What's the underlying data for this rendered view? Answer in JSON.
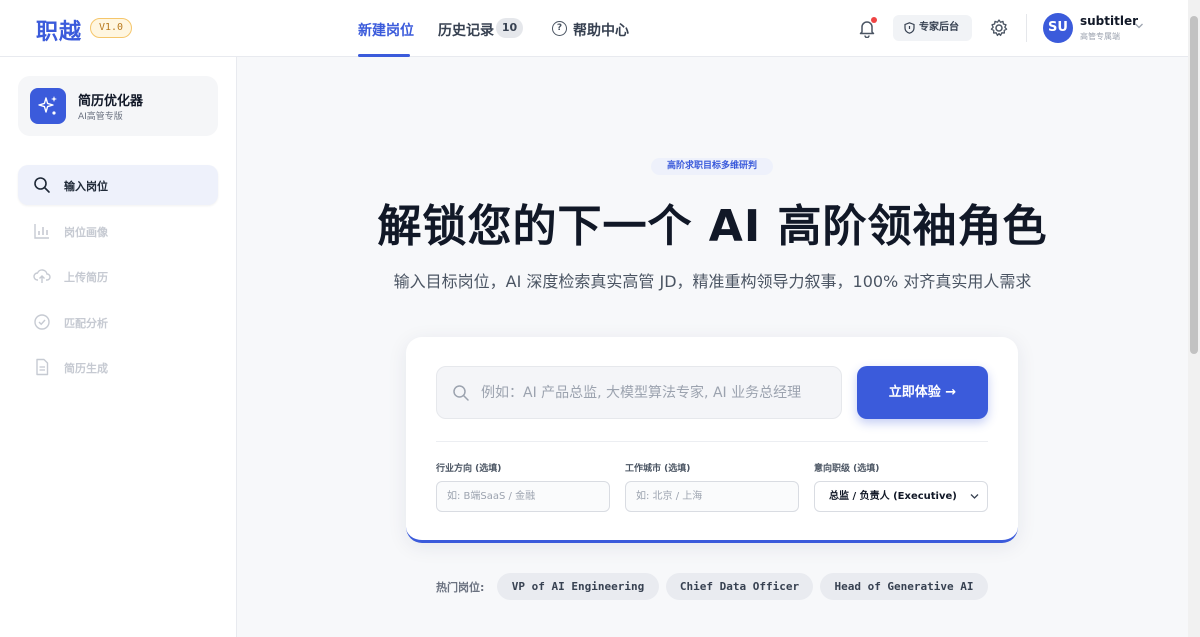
{
  "header": {
    "logo": "职越",
    "version": "V1.0",
    "tabs": [
      {
        "label": "新建岗位",
        "active": true
      },
      {
        "label": "历史记录",
        "badge": "10"
      },
      {
        "label": "帮助中心",
        "icon": "question-circle-icon"
      }
    ],
    "notification_icon": "bell-icon",
    "expert_label": "专家后台",
    "settings_icon": "gear-icon",
    "user": {
      "initials": "SU",
      "name": "subtitler",
      "role": "高管专属端"
    }
  },
  "sidebar": {
    "brand": {
      "title": "简历优化器",
      "subtitle": "AI高管专版"
    },
    "items": [
      {
        "label": "输入岗位",
        "icon": "search-icon",
        "active": true
      },
      {
        "label": "岗位画像",
        "icon": "bar-chart-icon"
      },
      {
        "label": "上传简历",
        "icon": "cloud-upload-icon"
      },
      {
        "label": "匹配分析",
        "icon": "check-circle-icon"
      },
      {
        "label": "简历生成",
        "icon": "document-icon"
      }
    ]
  },
  "hero": {
    "chip": "高阶求职目标多维研判",
    "title": "解锁您的下一个 AI 高阶领袖角色",
    "subtitle": "输入目标岗位，AI 深度检索真实高管 JD，精准重构领导力叙事，100% 对齐真实用人需求"
  },
  "search": {
    "placeholder": "例如：AI 产品总监, 大模型算法专家, AI 业务总经理",
    "value": "",
    "button_label": "立即体验 →"
  },
  "filters": {
    "industry": {
      "label": "行业方向 (选填)",
      "placeholder": "如: B端SaaS / 金融"
    },
    "city": {
      "label": "工作城市 (选填)",
      "placeholder": "如: 北京 / 上海"
    },
    "level": {
      "label": "意向职级 (选填)",
      "value": "总监 / 负责人 (Executive)"
    }
  },
  "hot": {
    "label": "热门岗位:",
    "tags": [
      "VP of AI Engineering",
      "Chief Data Officer",
      "Head of Generative AI"
    ]
  },
  "colors": {
    "accent": "#3b5bdb",
    "badge_warn": "#f5c66b",
    "alert": "#ef4444"
  }
}
